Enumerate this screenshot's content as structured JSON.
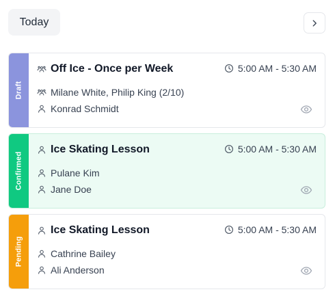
{
  "toolbar": {
    "today_label": "Today"
  },
  "colors": {
    "draft": "#8b94dd",
    "confirmed": "#10c981",
    "pending": "#f59e0b"
  },
  "events": [
    {
      "status": "Draft",
      "title": "Off Ice - Once per Week",
      "title_icon": "group-icon",
      "time": "5:00 AM - 5:30 AM",
      "line1": "Milane White, Philip King (2/10)",
      "line1_icon": "group-icon",
      "line2": "Konrad Schmidt",
      "line2_icon": "user-icon"
    },
    {
      "status": "Confirmed",
      "title": "Ice Skating Lesson",
      "title_icon": "user-icon",
      "time": "5:00 AM - 5:30 AM",
      "line1": "Pulane Kim",
      "line1_icon": "user-icon",
      "line2": "Jane Doe",
      "line2_icon": "user-icon"
    },
    {
      "status": "Pending",
      "title": "Ice Skating Lesson",
      "title_icon": "user-icon",
      "time": "5:00 AM - 5:30 AM",
      "line1": "Cathrine Bailey",
      "line1_icon": "user-icon",
      "line2": "Ali Anderson",
      "line2_icon": "user-icon"
    }
  ]
}
